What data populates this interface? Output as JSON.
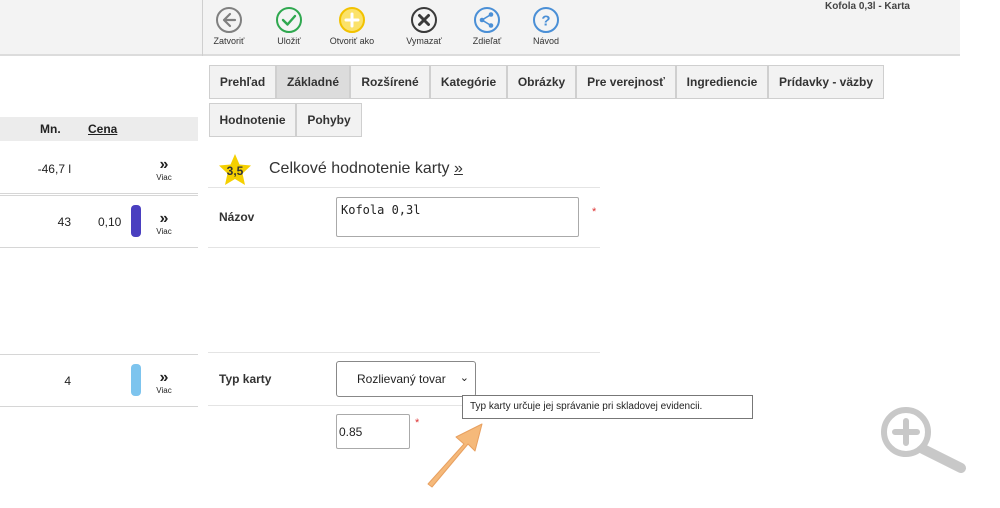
{
  "window_title": "Kofola 0,3l - Karta",
  "toolbar": {
    "close": "Zatvoriť",
    "save": "Uložiť",
    "open_as": "Otvoriť ako",
    "delete": "Vymazať",
    "share": "Zdieľať",
    "help": "Návod"
  },
  "left_panel": {
    "col_qty": "Mn.",
    "col_price": "Cena",
    "rows": [
      {
        "qty": "-46,7 l",
        "price": "",
        "more_icon": "»",
        "more_label": "Viac"
      },
      {
        "qty": "43",
        "price": "0,10",
        "bar_color": "#4a3fc0",
        "more_icon": "»",
        "more_label": "Viac"
      },
      {
        "qty": "4",
        "price": "",
        "bar_color": "#7dc4ee",
        "more_icon": "»",
        "more_label": "Viac"
      }
    ]
  },
  "tabs": [
    "Prehľad",
    "Základné",
    "Rozšírené",
    "Kategórie",
    "Obrázky",
    "Pre verejnosť",
    "Ingrediencie",
    "Prídavky - väzby",
    "Hodnotenie",
    "Pohyby"
  ],
  "active_tab": "Základné",
  "rating": {
    "value": "3,5",
    "title": "Celkové hodnotenie karty",
    "link": "»"
  },
  "form": {
    "name_label": "Názov",
    "name_value": "Kofola 0,3l",
    "required_mark": "*",
    "type_label": "Typ karty",
    "type_value": "Rozlievaný tovar",
    "type_caret": "⌄",
    "volume_value": "0.85"
  },
  "tooltip": "Typ karty určuje jej správanie pri skladovej evidencii.",
  "colors": {
    "close_icon": "#808080",
    "save_icon": "#2fa84f",
    "open_as_icon": "#f2c200",
    "delete_icon": "#3a3a3a",
    "share_icon": "#4a8fd6",
    "help_icon": "#4a8fd6",
    "star": "#f5d000",
    "arrow_overlay": "#f5b97a",
    "zoom_icon": "#c8c8c8"
  }
}
